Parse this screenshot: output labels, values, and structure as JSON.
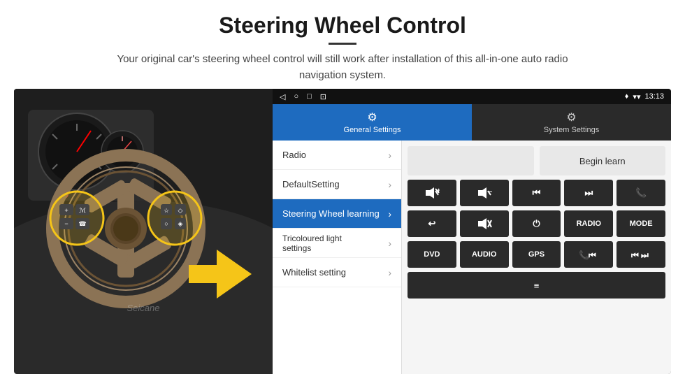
{
  "header": {
    "title": "Steering Wheel Control",
    "subtitle": "Your original car's steering wheel control will still work after installation of this all-in-one auto radio navigation system."
  },
  "status_bar": {
    "nav_back": "◁",
    "nav_home": "○",
    "nav_square": "□",
    "nav_dot": "⊡",
    "location_icon": "♦",
    "wifi_icon": "▾",
    "time": "13:13"
  },
  "tabs": {
    "general": {
      "label": "General Settings",
      "icon": "⚙"
    },
    "system": {
      "label": "System Settings",
      "icon": "⚙"
    }
  },
  "menu_items": [
    {
      "label": "Radio",
      "active": false
    },
    {
      "label": "DefaultSetting",
      "active": false
    },
    {
      "label": "Steering Wheel learning",
      "active": true
    },
    {
      "label": "Tricoloured light settings",
      "active": false
    },
    {
      "label": "Whitelist setting",
      "active": false
    }
  ],
  "begin_learn_label": "Begin learn",
  "control_buttons_row1": [
    {
      "label": "🔊+",
      "key": "vol-up"
    },
    {
      "label": "🔊−",
      "key": "vol-down"
    },
    {
      "label": "⏮",
      "key": "prev"
    },
    {
      "label": "⏭",
      "key": "next"
    },
    {
      "label": "📞",
      "key": "phone"
    }
  ],
  "control_buttons_row2": [
    {
      "label": "↩",
      "key": "hang-up"
    },
    {
      "label": "🔇",
      "key": "mute"
    },
    {
      "label": "⏻",
      "key": "power"
    },
    {
      "label": "RADIO",
      "key": "radio"
    },
    {
      "label": "MODE",
      "key": "mode"
    }
  ],
  "control_buttons_row3": [
    {
      "label": "DVD",
      "key": "dvd"
    },
    {
      "label": "AUDIO",
      "key": "audio"
    },
    {
      "label": "GPS",
      "key": "gps"
    },
    {
      "label": "📞⏮",
      "key": "phone-prev"
    },
    {
      "label": "⏮⏭",
      "key": "seek"
    }
  ],
  "control_buttons_row4": [
    {
      "label": "≡",
      "key": "menu-icon"
    }
  ],
  "watermark": "Seicane"
}
